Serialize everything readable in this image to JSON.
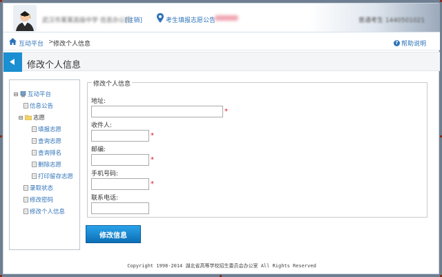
{
  "header": {
    "school_name": "武汉市某某高级中学 信息办公司",
    "logout_label": "[注销]",
    "notice_label": "考生填报志愿公告",
    "user_info": "普通考生  1440501021",
    "pin_color": "#2f73b8"
  },
  "breadcrumb": {
    "home_label": "互动平台",
    "separator": ">",
    "current": "修改个人信息",
    "help_label": "帮助说明"
  },
  "page": {
    "title": "修改个人信息"
  },
  "tree": {
    "root": "互动平台",
    "items": [
      "信息公告",
      "志愿",
      "填报志愿",
      "查询志愿",
      "查询排名",
      "删除志愿",
      "打印留存志愿",
      "录取状态",
      "修改密码",
      "修改个人信息"
    ],
    "expand_symbol": "⊟"
  },
  "form": {
    "legend": "修改个人信息",
    "fields": [
      {
        "label": "地址:",
        "value": "",
        "required": true
      },
      {
        "label": "收件人:",
        "value": "",
        "required": true
      },
      {
        "label": "邮编:",
        "value": "",
        "required": true
      },
      {
        "label": "手机号码:",
        "value": "",
        "required": true
      },
      {
        "label": "联系电话:",
        "value": "",
        "required": false
      }
    ],
    "required_mark": "*",
    "submit_label": "修改信息"
  },
  "footer": {
    "copyright": "Copyright 1998-2014 湖北省高等学校招生委员会办公室 All Rights Reserved"
  },
  "colors": {
    "accent": "#1a8fd1",
    "link": "#2f73b8",
    "required": "#e0102a"
  }
}
